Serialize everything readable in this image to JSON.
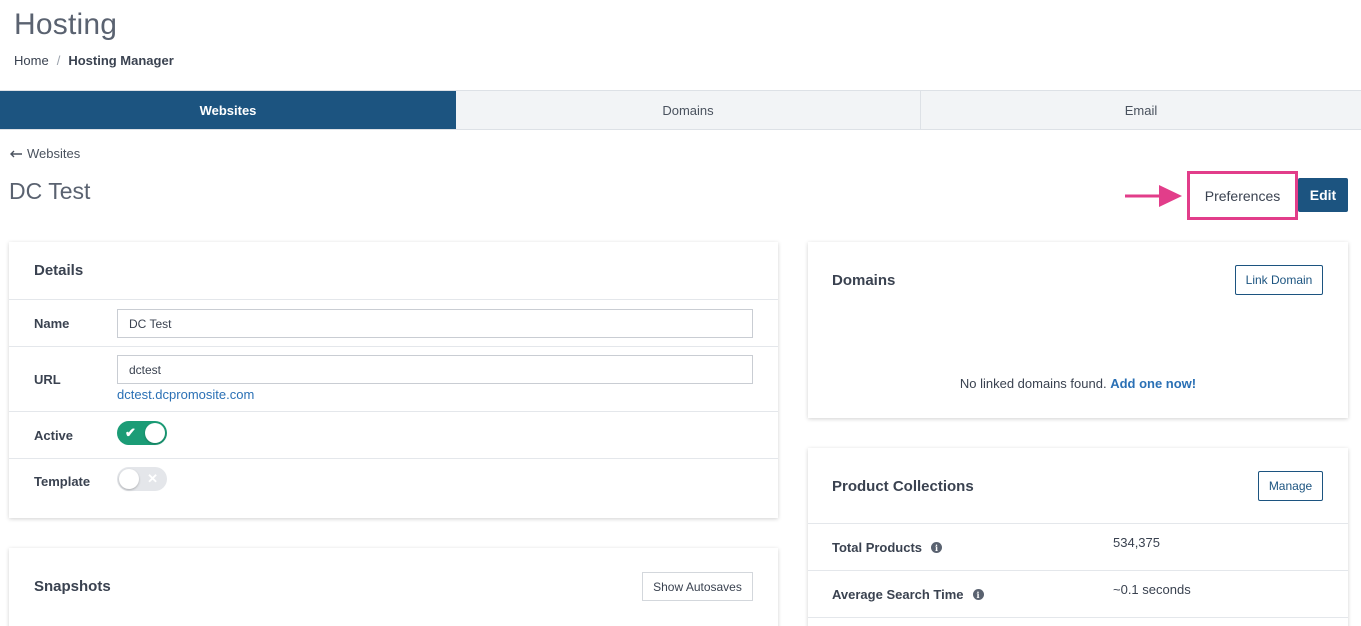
{
  "header": {
    "title": "Hosting",
    "breadcrumb": {
      "home": "Home",
      "separator": "/",
      "current": "Hosting Manager"
    }
  },
  "tabs": [
    {
      "label": "Websites",
      "active": true
    },
    {
      "label": "Domains",
      "active": false
    },
    {
      "label": "Email",
      "active": false
    }
  ],
  "site": {
    "back_label": "Websites",
    "back_icon": "arrow-left-icon",
    "title": "DC Test",
    "preferences_label": "Preferences",
    "edit_label": "Edit"
  },
  "details": {
    "heading": "Details",
    "name_label": "Name",
    "name_value": "DC Test",
    "url_label": "URL",
    "url_value": "dctest",
    "url_link": "dctest.dcpromosite.com",
    "active_label": "Active",
    "active_on": true,
    "template_label": "Template",
    "template_on": false
  },
  "snapshots": {
    "heading": "Snapshots",
    "show_autosaves_label": "Show Autosaves"
  },
  "domains_card": {
    "heading": "Domains",
    "link_domain_label": "Link Domain",
    "empty_text": "No linked domains found.",
    "add_link": "Add one now!"
  },
  "product_collections": {
    "heading": "Product Collections",
    "manage_label": "Manage",
    "stats": [
      {
        "label": "Total Products",
        "value": "534,375"
      },
      {
        "label": "Average Search Time",
        "value": "~0.1 seconds"
      }
    ]
  },
  "colors": {
    "primary": "#1c5480",
    "toggle_on": "#1b9c76",
    "link": "#2a70b5",
    "highlight": "#e23d8a"
  }
}
